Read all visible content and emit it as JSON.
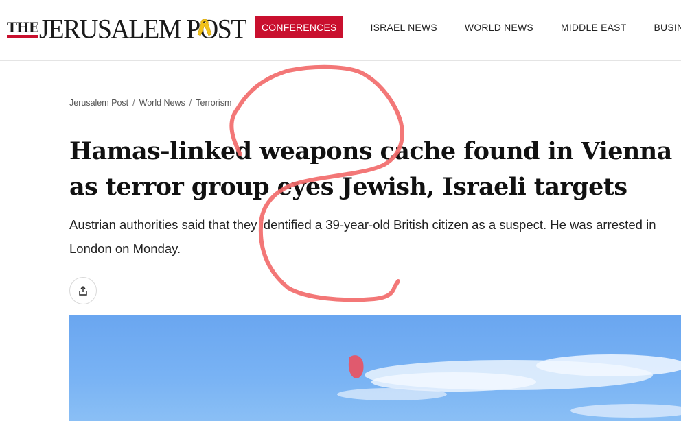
{
  "header": {
    "logo": {
      "the": "THE",
      "name": "JERUSALEM POST"
    },
    "nav": {
      "highlight": "CONFERENCES",
      "items": [
        "ISRAEL NEWS",
        "WORLD NEWS",
        "MIDDLE EAST",
        "BUSINESS &"
      ]
    },
    "colors": {
      "brand_red": "#c9102e",
      "ribbon_yellow": "#f2c21a"
    }
  },
  "breadcrumb": [
    "Jerusalem Post",
    "World News",
    "Terrorism"
  ],
  "article": {
    "headline": "Hamas-linked weapons cache found in Vienna as terror group eyes Jewish, Israeli targets",
    "subhead": "Austrian authorities said that they identified a 39-year-old British citizen as a suspect. He was arrested in London on Monday.",
    "share_icon": "share-icon"
  },
  "hero_image": {
    "description_icon": "sky-photo",
    "color": "#6aa6f0"
  },
  "annotation": {
    "color": "#f26b6b"
  }
}
